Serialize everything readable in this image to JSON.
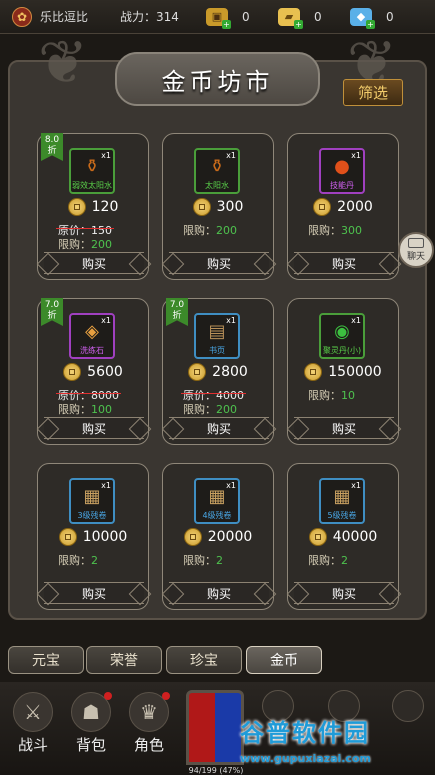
{
  "topbar": {
    "player_name": "乐比逗比",
    "power_label": "战力：",
    "power_value": "314",
    "gold_value": "0",
    "ingot_value": "0",
    "diamond_value": "0"
  },
  "shop": {
    "title": "金币坊市",
    "filter_label": "筛选",
    "buy_label": "购买",
    "orig_label": "原价：",
    "limit_label": "限购："
  },
  "items": [
    {
      "name": "弱效太阳水",
      "qty": "x1",
      "discount": "8.0\n折",
      "price": "120",
      "orig": "150",
      "limit": "200",
      "frame": "green",
      "icon": "potion-icon"
    },
    {
      "name": "太阳水",
      "qty": "x1",
      "discount": "",
      "price": "300",
      "orig": "",
      "limit": "200",
      "frame": "green",
      "icon": "potion-icon"
    },
    {
      "name": "技能丹",
      "qty": "x1",
      "discount": "",
      "price": "2000",
      "orig": "",
      "limit": "300",
      "frame": "purple",
      "icon": "pill-icon"
    },
    {
      "name": "洗练石",
      "qty": "x1",
      "discount": "7.0\n折",
      "price": "5600",
      "orig": "8000",
      "limit": "100",
      "frame": "purple",
      "icon": "stone-icon"
    },
    {
      "name": "书页",
      "qty": "x1",
      "discount": "7.0\n折",
      "price": "2800",
      "orig": "4000",
      "limit": "200",
      "frame": "blue",
      "icon": "page-icon"
    },
    {
      "name": "聚灵丹(小)",
      "qty": "x1",
      "discount": "",
      "price": "150000",
      "orig": "",
      "limit": "10",
      "frame": "green",
      "icon": "orb-icon"
    },
    {
      "name": "3级残卷",
      "qty": "x1",
      "discount": "",
      "price": "10000",
      "orig": "",
      "limit": "2",
      "frame": "blue",
      "icon": "scroll-icon"
    },
    {
      "name": "4级残卷",
      "qty": "x1",
      "discount": "",
      "price": "20000",
      "orig": "",
      "limit": "2",
      "frame": "blue",
      "icon": "scroll-icon"
    },
    {
      "name": "5级残卷",
      "qty": "x1",
      "discount": "",
      "price": "40000",
      "orig": "",
      "limit": "2",
      "frame": "blue",
      "icon": "scroll-icon"
    }
  ],
  "chat_label": "聊天",
  "tabs": [
    "元宝",
    "荣誉",
    "珍宝",
    "金币"
  ],
  "active_tab": "金币",
  "nav": [
    {
      "label": "战斗",
      "icon": "swords-icon"
    },
    {
      "label": "背包",
      "icon": "bag-icon"
    },
    {
      "label": "角色",
      "icon": "helmet-icon"
    }
  ],
  "exp_text": "94/199 (47%)",
  "watermark": {
    "title": "谷普软件园",
    "url": "www.gupuxiazai.com"
  },
  "colors": {
    "accent_gold": "#f3cc6b",
    "limit_green": "#4ec24e",
    "strike_red": "#e03030"
  }
}
